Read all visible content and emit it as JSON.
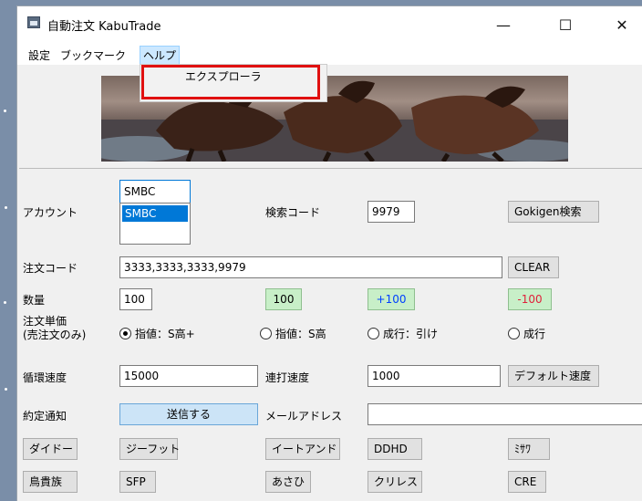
{
  "window": {
    "title": "自動注文 KabuTrade",
    "minimize": "—",
    "maximize": "☐",
    "close": "✕"
  },
  "menu": {
    "items": [
      "設定",
      "ブックマーク",
      "ヘルプ"
    ],
    "dropdown_item": "エクスプローラ"
  },
  "account": {
    "label": "アカウント",
    "combo_value": "SMBC",
    "list_selected": "SMBC",
    "search_label": "検索コード",
    "search_value": "9979",
    "search_button": "Gokigen検索"
  },
  "order_code": {
    "label": "注文コード",
    "value": "3333,3333,3333,9979",
    "clear_button": "CLEAR"
  },
  "quantity": {
    "label": "数量",
    "value": "100",
    "btn_100": "100",
    "btn_plus100": "+100",
    "btn_minus100": "-100"
  },
  "price": {
    "label_line1": "注文単価",
    "label_line2": "(売注文のみ)",
    "options": [
      "指値：S高+",
      "指値：S高",
      "成行：引け",
      "成行"
    ],
    "selected_index": 0
  },
  "speed": {
    "cycle_label": "循環速度",
    "cycle_value": "15000",
    "rapid_label": "連打速度",
    "rapid_value": "1000",
    "default_button": "デフォルト速度"
  },
  "notify": {
    "label": "約定通知",
    "send_button": "送信する",
    "mail_label": "メールアドレス",
    "mail_value": ""
  },
  "bookmarks_row1": [
    "ダイドー",
    "ジーフット",
    "イートアンド",
    "DDHD",
    "ﾐｻﾜ"
  ],
  "bookmarks_row2": [
    "鳥貴族",
    "SFP",
    "あさひ",
    "クリレス",
    "CRE"
  ],
  "colors": {
    "accent": "#0078d7",
    "highlight_red": "#e01010",
    "green_btn": "#c8efc8"
  }
}
